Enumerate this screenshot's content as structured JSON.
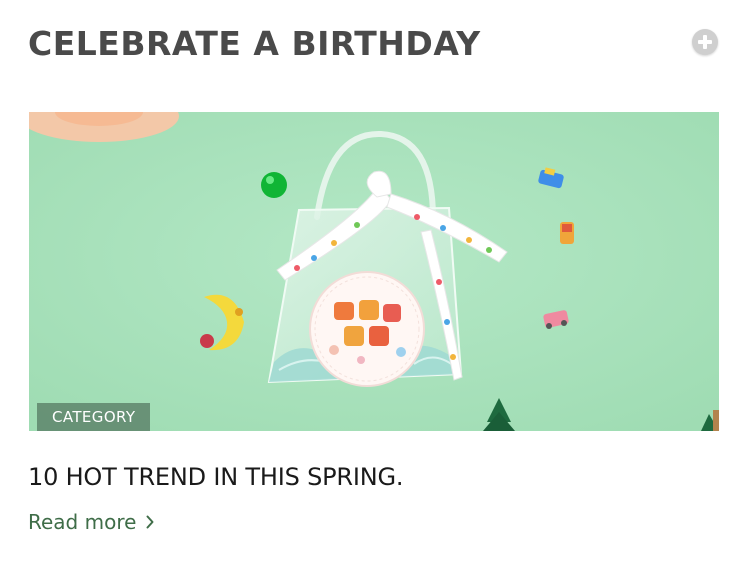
{
  "section": {
    "title": "CELEBRATE A BIRTHDAY",
    "expand_icon": "plus-circle-icon"
  },
  "post": {
    "image_alt": "Clear gift bag with birthday ribbon and sticker on a mint green background",
    "category": "CATEGORY",
    "title": "10 HOT TREND IN THIS SPRING.",
    "read_more": "Read more",
    "read_more_icon": "chevron-right-icon"
  },
  "colors": {
    "title_text": "#4a4a4a",
    "post_title_text": "#1a1a1a",
    "link_green": "#3f6d48",
    "image_background": "#a9e2bb",
    "badge_background": "#5a7a64"
  }
}
